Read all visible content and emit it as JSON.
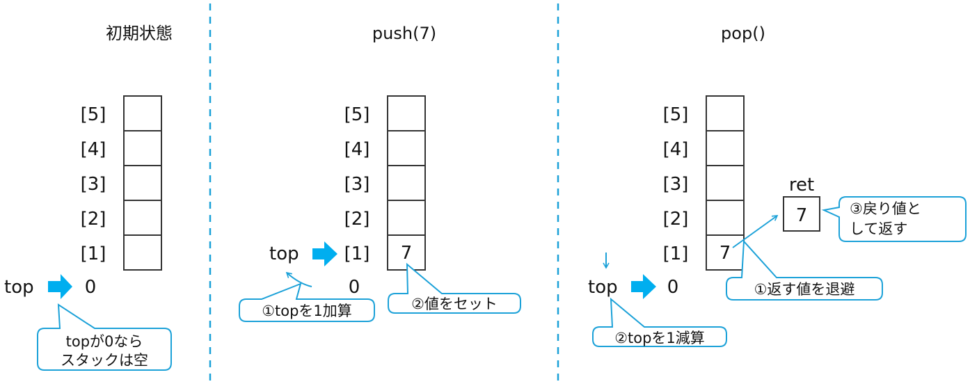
{
  "panels": [
    {
      "title": "初期状態",
      "indices": [
        "[5]",
        "[4]",
        "[3]",
        "[2]",
        "[1]"
      ],
      "cells": [
        "",
        "",
        "",
        "",
        ""
      ],
      "top_label": "top",
      "top_target": "0",
      "callouts": [
        {
          "lines": [
            "topが0なら",
            "スタックは空"
          ]
        }
      ]
    },
    {
      "title": "push(7)",
      "indices": [
        "[5]",
        "[4]",
        "[3]",
        "[2]",
        "[1]"
      ],
      "cells": [
        "",
        "",
        "",
        "",
        "7"
      ],
      "top_label": "top",
      "top_target": "[1]",
      "old_value": "0",
      "callouts": [
        {
          "lines": [
            "①topを1加算"
          ]
        },
        {
          "lines": [
            "②値をセット"
          ]
        }
      ]
    },
    {
      "title": "pop()",
      "indices": [
        "[5]",
        "[4]",
        "[3]",
        "[2]",
        "[1]"
      ],
      "cells": [
        "",
        "",
        "",
        "",
        "7"
      ],
      "top_label": "top",
      "top_target": "0",
      "ret_label": "ret",
      "ret_value": "7",
      "callouts": [
        {
          "lines": [
            "①返す値を退避"
          ]
        },
        {
          "lines": [
            "②topを1減算"
          ]
        },
        {
          "lines": [
            "③戻り値と",
            "して返す"
          ]
        }
      ]
    }
  ],
  "colors": {
    "accent": "#1ba1d8",
    "arrow": "#00aeef",
    "cell_border": "#333333"
  },
  "icons": {
    "pointer_arrow": "right-block-arrow",
    "small_arrow": "down-arrow"
  }
}
